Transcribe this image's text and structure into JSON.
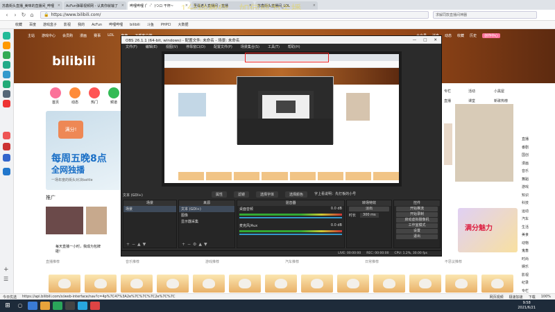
{
  "browser": {
    "tabs": [
      {
        "label": "苏鑫街头直播_美味的直播间_哔哩"
      },
      {
        "label": "AcFun弹幕视频网 - 认真你就输了"
      },
      {
        "label": "哔哩哔哩 (゜-゜)つロ 干杯~"
      },
      {
        "label": "圣诞老人直播间 - 直播"
      },
      {
        "label": "苏鑫街头直播间_LOL"
      }
    ],
    "url": "https://www.bilibili.com/",
    "search_placeholder": "求解同款直播间神器",
    "watermark": "1分钟教你，如何成为主播",
    "bookmarks": [
      "收藏",
      "百度",
      "游戏盒子",
      "影视",
      "我的",
      "AcFun",
      "哔哩哔哩",
      "bilibili",
      "斗鱼",
      "PHPCl",
      "大数据"
    ]
  },
  "bili": {
    "top_nav": [
      "主站",
      "游戏中心",
      "会员购",
      "漫画",
      "赛事",
      "LOL",
      "电竞",
      "下载客户端"
    ],
    "top_nav_right": [
      "大会员",
      "消息",
      "动态",
      "收藏",
      "历史",
      "创作中心"
    ],
    "logo": "bilibili",
    "channels": [
      "首页",
      "动态",
      "热门",
      "频道"
    ],
    "promo": {
      "badge": "满分!",
      "line1": "每周五晚8点",
      "line2": "全网独播",
      "line3": "一场年度的街头对决battle"
    },
    "right_links": [
      "专栏",
      "活动",
      "小黑屋",
      "直播",
      "课堂",
      "新歌热榜"
    ],
    "section_title": "推广",
    "thumb_caption_1": "每天直播一小时，我成为包牌砸!",
    "row_labels": [
      "直播推荐",
      "音乐推荐",
      "游戏推荐",
      "汽车推荐",
      "日常推荐",
      "不思议推荐"
    ],
    "gift_text": "满分魅力",
    "right_sidenav": [
      "直播",
      "番剧",
      "国创",
      "漫画",
      "音乐",
      "舞蹈",
      "游戏",
      "知识",
      "科技",
      "运动",
      "汽车",
      "生活",
      "美食",
      "动物",
      "鬼畜",
      "时尚",
      "娱乐",
      "影视",
      "纪录",
      "专栏"
    ]
  },
  "obs": {
    "title": "OBS 26.1.1 (64-bit, windows) - 配置文件: 未命名 - 场景: 未命名",
    "menu": [
      "文件(F)",
      "编辑(E)",
      "视图(V)",
      "停靠窗口(D)",
      "配置文件(P)",
      "场景集合(S)",
      "工具(T)",
      "帮助(H)"
    ],
    "window_controls": [
      "—",
      "□",
      "✕"
    ],
    "source_label": "文本 (GDI+)",
    "tab_buttons": [
      "属性",
      "滤镜",
      "选择字体",
      "选择颜色",
      "字上看说明：先打板的小号"
    ],
    "docks": {
      "scenes": {
        "title": "场景",
        "items": [
          "场景"
        ]
      },
      "sources": {
        "title": "来源",
        "items": [
          "文本 (GDI+)",
          "图像",
          "显示器采集"
        ]
      },
      "mixer": {
        "title": "混音器",
        "tracks": [
          {
            "name": "桌面音频",
            "db": "0.0 dB"
          },
          {
            "name": "麦克风/Aux",
            "db": "0.0 dB"
          }
        ]
      },
      "transitions": {
        "title": "转场特效",
        "type": "淡出",
        "duration_label": "时长",
        "duration": "300 ms"
      },
      "controls": {
        "title": "控件",
        "buttons": [
          "开始推流",
          "开始录制",
          "启动虚拟摄像机",
          "工作室模式",
          "设置",
          "退出"
        ]
      }
    },
    "status": [
      "LIVE: 00:00:00",
      "REC: 00:00:00",
      "CPU: 1.2%, 30.00 fps"
    ]
  },
  "statusbar": {
    "left": "今日优选",
    "url": "https://api.bilibili.com/x/web-interface/nav?c=4p%7C47%3A2e%7C%7C%7C2e%7C%7C",
    "right": [
      "网页视频",
      "极速加速",
      "下载",
      "100%"
    ]
  },
  "clock": {
    "time": "9:58",
    "date": "2021/6/21"
  }
}
